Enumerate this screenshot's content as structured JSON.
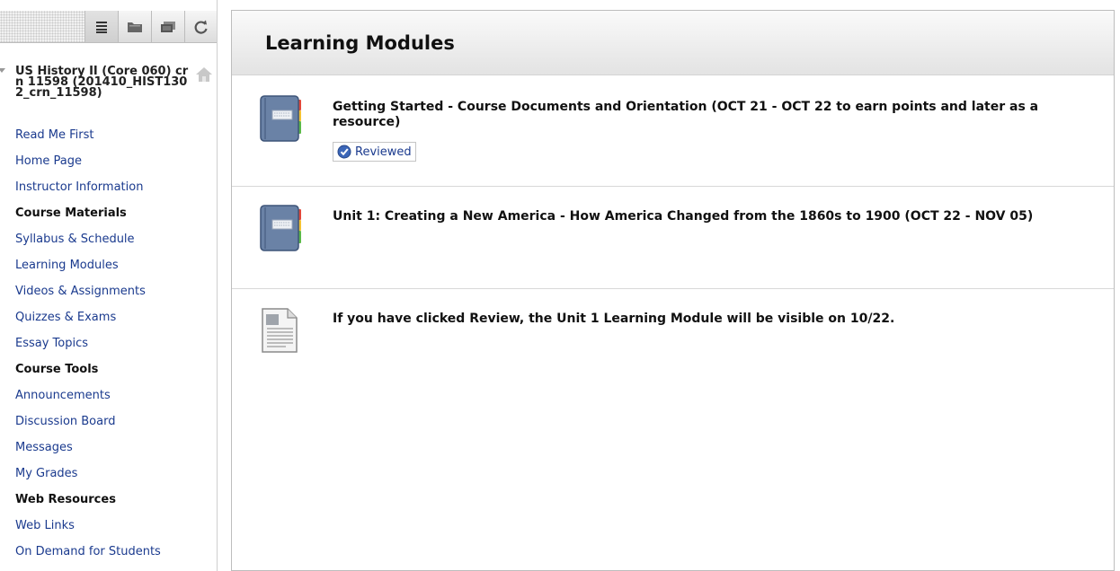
{
  "sidebar": {
    "toolbar": {
      "buttons": [
        {
          "name": "list-view",
          "icon": "list-icon",
          "active": true
        },
        {
          "name": "folder-view",
          "icon": "folder-icon",
          "active": false
        },
        {
          "name": "window-view",
          "icon": "window-icon",
          "active": false
        },
        {
          "name": "refresh",
          "icon": "refresh-icon",
          "active": false
        }
      ]
    },
    "course_title": "US History II (Core 060) crn 11598 (201410_HIST1302_crn_11598)",
    "items": [
      {
        "label": "Read Me First",
        "type": "link"
      },
      {
        "label": "Home Page",
        "type": "link"
      },
      {
        "label": "Instructor Information",
        "type": "link"
      },
      {
        "label": "Course Materials",
        "type": "heading"
      },
      {
        "label": "Syllabus & Schedule",
        "type": "link"
      },
      {
        "label": "Learning Modules",
        "type": "link"
      },
      {
        "label": "Videos & Assignments",
        "type": "link"
      },
      {
        "label": "Quizzes & Exams",
        "type": "link"
      },
      {
        "label": "Essay Topics",
        "type": "link"
      },
      {
        "label": "Course Tools",
        "type": "heading"
      },
      {
        "label": "Announcements",
        "type": "link"
      },
      {
        "label": "Discussion Board",
        "type": "link"
      },
      {
        "label": "Messages",
        "type": "link"
      },
      {
        "label": "My Grades",
        "type": "link"
      },
      {
        "label": "Web Resources",
        "type": "heading"
      },
      {
        "label": "Web Links",
        "type": "link"
      },
      {
        "label": "On Demand for Students",
        "type": "link"
      }
    ]
  },
  "content": {
    "page_title": "Learning Modules",
    "items": [
      {
        "title": "Getting Started - Course Documents and Orientation (OCT 21 - OCT 22 to earn points and later as a resource)",
        "icon": "learning-module-icon",
        "badge": "Reviewed"
      },
      {
        "title": "Unit 1: Creating a New America - How America Changed from the 1860s to 1900 (OCT 22 - NOV 05)",
        "icon": "learning-module-icon"
      },
      {
        "title": "If you have clicked Review, the Unit 1 Learning Module will be visible on 10/22.",
        "icon": "document-icon"
      }
    ]
  },
  "colors": {
    "link": "#1a3a8e",
    "heading": "#111111",
    "module_book": "#6a82a6"
  }
}
